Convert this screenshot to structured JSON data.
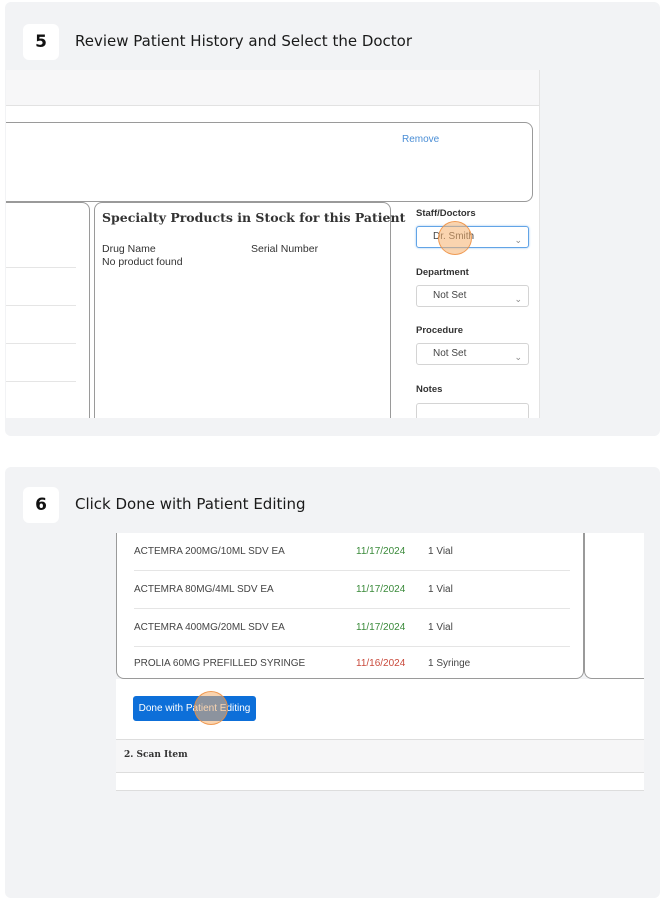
{
  "steps": [
    {
      "number": "5",
      "title": "Review Patient History and Select the Doctor"
    },
    {
      "number": "6",
      "title": "Click Done with Patient Editing"
    }
  ],
  "screen5": {
    "remove_link": "Remove",
    "specialty_panel": {
      "title": "Specialty Products in Stock for this Patient",
      "columns": [
        "Drug Name",
        "Serial Number"
      ],
      "empty_message": "No product found"
    },
    "form": {
      "staff_label": "Staff/Doctors",
      "staff_value": "Dr. Smith",
      "department_label": "Department",
      "department_value": "Not Set",
      "procedure_label": "Procedure",
      "procedure_value": "Not Set",
      "notes_label": "Notes"
    }
  },
  "screen6": {
    "items": [
      {
        "name": "ACTEMRA 200MG/10ML SDV EA",
        "date": "11/17/2024",
        "date_color": "#3a8a3a",
        "qty": "1 Vial"
      },
      {
        "name": "ACTEMRA 80MG/4ML SDV EA",
        "date": "11/17/2024",
        "date_color": "#3a8a3a",
        "qty": "1 Vial"
      },
      {
        "name": "ACTEMRA 400MG/20ML SDV EA",
        "date": "11/17/2024",
        "date_color": "#3a8a3a",
        "qty": "1 Vial"
      },
      {
        "name": "PROLIA 60MG PREFILLED SYRINGE",
        "date": "11/16/2024",
        "date_color": "#c94a3c",
        "qty": "1 Syringe"
      }
    ],
    "done_button": "Done with Patient Editing",
    "scan_section_title": "2. Scan Item"
  },
  "colors": {
    "primary_button": "#0d6fd9",
    "link": "#4a8ed6",
    "highlight": "#f6b06e"
  }
}
